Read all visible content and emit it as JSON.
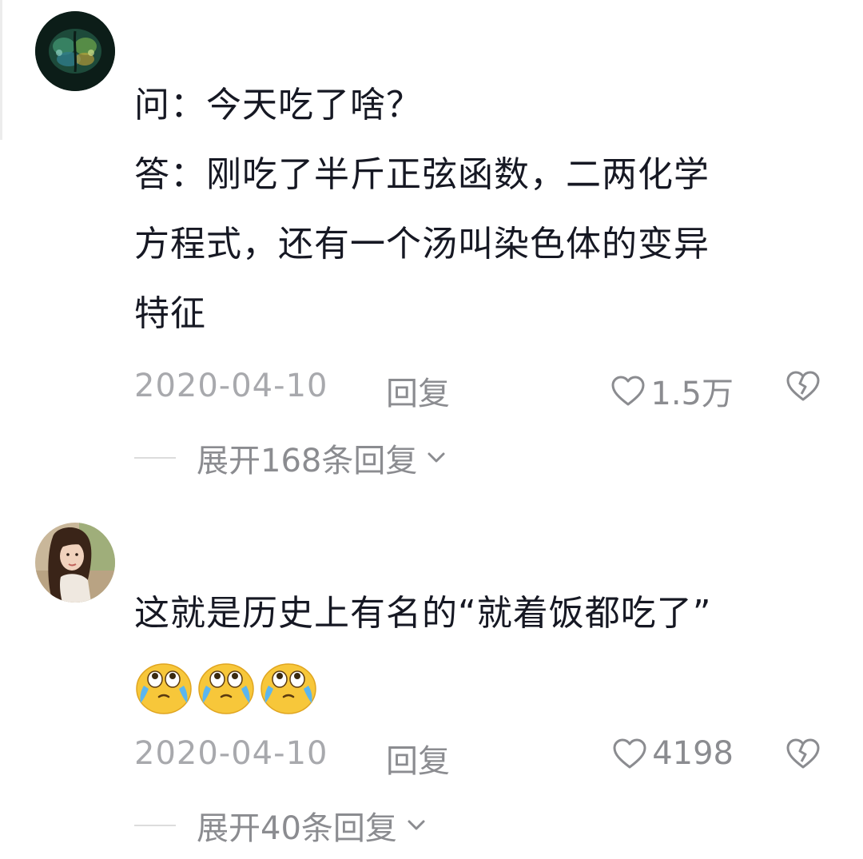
{
  "comments": [
    {
      "avatar_icon": "brain-avatar",
      "lines": [
        "问：今天吃了啥？",
        "答：刚吃了半斤正弦函数，二两化学",
        "方程式，还有一个汤叫染色体的变异",
        "特征"
      ],
      "date": "2020-04-10",
      "reply_label": "回复",
      "like_count": "1.5万",
      "expand_label": "展开168条回复"
    },
    {
      "avatar_icon": "girl-avatar",
      "lines": [
        "这就是历史上有名的“就着饭都吃了”"
      ],
      "emojis": [
        "crying-emoji",
        "crying-emoji",
        "crying-emoji"
      ],
      "date": "2020-04-10",
      "reply_label": "回复",
      "like_count": "4198",
      "expand_label": "展开40条回复"
    }
  ],
  "colors": {
    "text": "#161823",
    "meta": "#a8a9ad",
    "action": "#8b8c90"
  }
}
